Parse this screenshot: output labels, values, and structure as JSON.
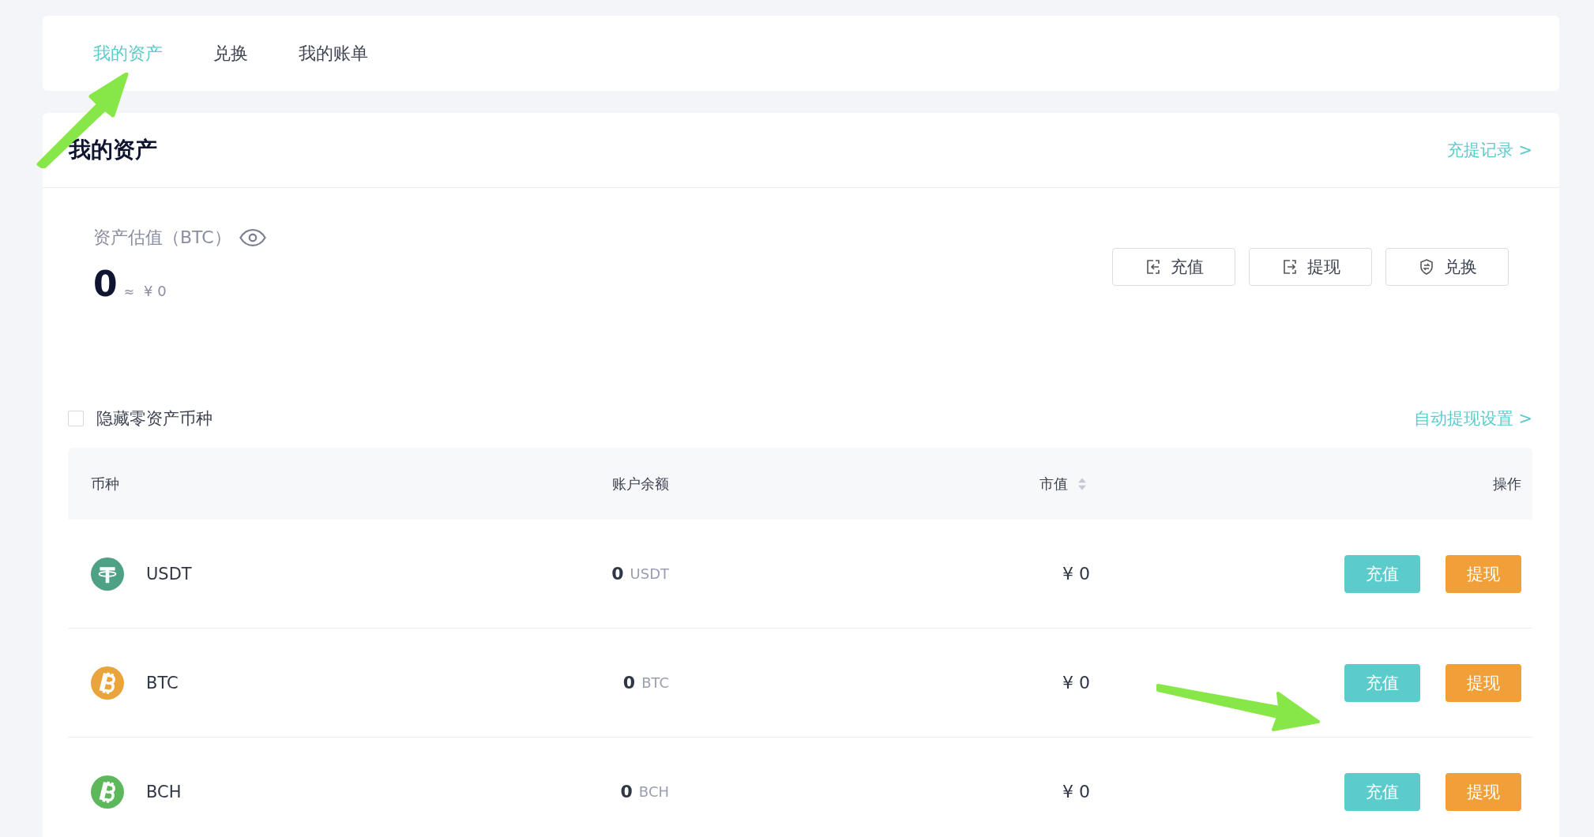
{
  "tabs": [
    {
      "label": "我的资产",
      "selected": true
    },
    {
      "label": "兑换",
      "selected": false
    },
    {
      "label": "我的账单",
      "selected": false
    }
  ],
  "section": {
    "title": "我的资产",
    "link": "充提记录 >"
  },
  "estimate": {
    "label": "资产估值（BTC）",
    "amount": "0",
    "approx": "≈",
    "cny": "¥ 0",
    "buttons": [
      {
        "label": "充值",
        "kind": "deposit"
      },
      {
        "label": "提现",
        "kind": "withdraw"
      },
      {
        "label": "兑换",
        "kind": "exchange"
      }
    ]
  },
  "filter": {
    "label": "隐藏零资产币种",
    "checked": false
  },
  "auto_link": "自动提现设置 >",
  "table": {
    "columns": [
      {
        "label": "币种",
        "sortable": false
      },
      {
        "label": "账户余额",
        "sortable": false
      },
      {
        "label": "市值",
        "sortable": true
      },
      {
        "label": "操作",
        "sortable": false
      }
    ],
    "rows": [
      {
        "coin": "USDT",
        "kind": "tether",
        "color": "#4ea184",
        "balance": "0",
        "unit": "USDT",
        "value": "¥ 0",
        "actions": [
          {
            "label": "充值",
            "kind": "deposit"
          },
          {
            "label": "提现",
            "kind": "withdraw"
          }
        ]
      },
      {
        "coin": "BTC",
        "kind": "bitcoin",
        "color": "#eaa43c",
        "balance": "0",
        "unit": "BTC",
        "value": "¥ 0",
        "actions": [
          {
            "label": "充值",
            "kind": "deposit"
          },
          {
            "label": "提现",
            "kind": "withdraw"
          }
        ]
      },
      {
        "coin": "BCH",
        "kind": "bitcoin",
        "color": "#5db75b",
        "balance": "0",
        "unit": "BCH",
        "value": "¥ 0",
        "actions": [
          {
            "label": "充值",
            "kind": "deposit"
          },
          {
            "label": "提现",
            "kind": "withdraw"
          }
        ]
      }
    ]
  }
}
